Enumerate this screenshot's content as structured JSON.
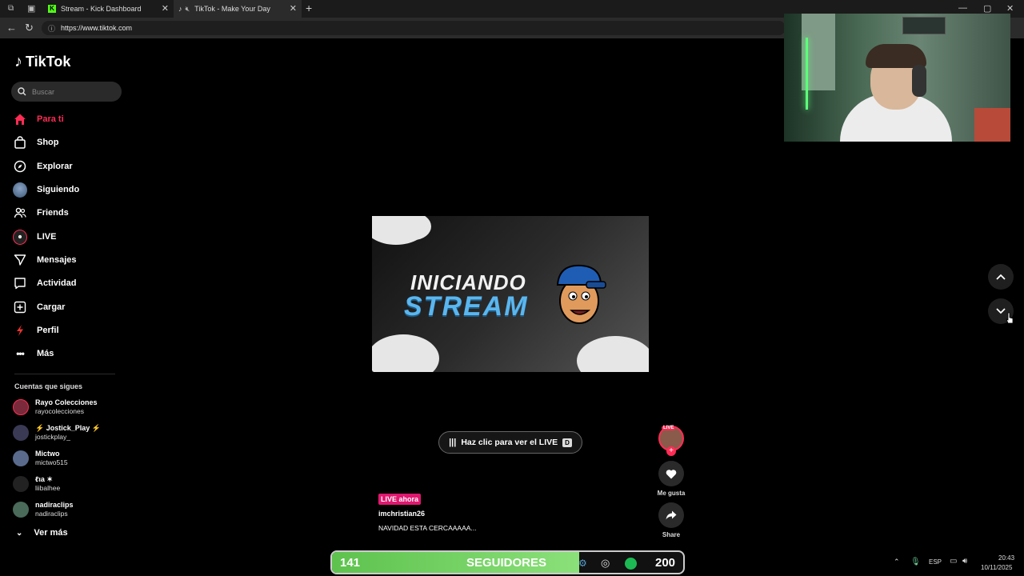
{
  "browser": {
    "tabs": [
      {
        "title": "Stream - Kick Dashboard",
        "close": "✕"
      },
      {
        "title": "TikTok - Make Your Day",
        "close": "✕"
      }
    ],
    "new_tab": "+",
    "url": "https://www.tiktok.com",
    "controls": {
      "minimize": "—",
      "maximize": "▢",
      "close": "✕"
    }
  },
  "sidebar": {
    "brand": "TikTok",
    "search_placeholder": "Buscar",
    "nav": [
      {
        "label": "Para ti",
        "icon": "home-icon"
      },
      {
        "label": "Shop",
        "icon": "shop-bag-icon"
      },
      {
        "label": "Explorar",
        "icon": "compass-icon"
      },
      {
        "label": "Siguiendo",
        "icon": "following-avatar-icon"
      },
      {
        "label": "Friends",
        "icon": "friends-icon"
      },
      {
        "label": "LIVE",
        "icon": "live-icon"
      },
      {
        "label": "Mensajes",
        "icon": "send-icon"
      },
      {
        "label": "Actividad",
        "icon": "activity-icon"
      },
      {
        "label": "Cargar",
        "icon": "upload-icon"
      },
      {
        "label": "Perfil",
        "icon": "profile-icon"
      },
      {
        "label": "Más",
        "icon": "more-icon"
      }
    ],
    "following_title": "Cuentas que sigues",
    "accounts": [
      {
        "name": "Rayo Colecciones",
        "handle": "rayocolecciones"
      },
      {
        "name": "⚡ Jostick_Play ⚡",
        "handle": "jostickplay_"
      },
      {
        "name": "Mictwo",
        "handle": "mictwo515"
      },
      {
        "name": "ℓιa ✶",
        "handle": "liibalhee"
      },
      {
        "name": "nadiraclips",
        "handle": "nadiraclips"
      }
    ],
    "see_more": "Ver más"
  },
  "player": {
    "thumbnail_line1": "INICIANDO",
    "thumbnail_line2": "STREAM",
    "cta": "Haz clic para ver el LIVE",
    "cta_key": "D",
    "live_badge": "LIVE ahora",
    "username": "imchristian26",
    "description": "NAVIDAD ESTA CERCAAAAA...",
    "avatar_badge": "LIVE",
    "like_label": "Me gusta",
    "share_label": "Share"
  },
  "overlay": {
    "followers_current": "141",
    "followers_label": "SEGUIDORES",
    "followers_goal": "200",
    "progress": 0.705
  },
  "taskbar": {
    "lang": "ESP",
    "time": "20:43",
    "date": "10/11/2025"
  },
  "colors": {
    "accent": "#fe2c55",
    "live": "#e0186f",
    "progress": "#5ec24e"
  }
}
